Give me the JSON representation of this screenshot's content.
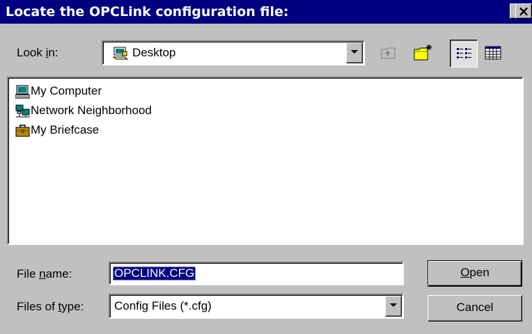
{
  "window": {
    "title": "Locate the OPCLink configuration file:",
    "help_label": "?",
    "close_label": "×"
  },
  "look_in": {
    "label_pre": "Look ",
    "label_accel": "i",
    "label_post": "n:",
    "value": "Desktop",
    "icon": "desktop-icon"
  },
  "toolbar": {
    "up_icon": "up-one-level-icon",
    "new_folder_icon": "new-folder-icon",
    "list_icon": "list-view-icon",
    "details_icon": "details-view-icon"
  },
  "files": [
    {
      "name": "My Computer",
      "icon": "computer-icon"
    },
    {
      "name": "Network Neighborhood",
      "icon": "network-icon"
    },
    {
      "name": "My Briefcase",
      "icon": "briefcase-icon"
    }
  ],
  "file_name": {
    "label_pre": "File ",
    "label_accel": "n",
    "label_post": "ame:",
    "value": "OPCLINK.CFG"
  },
  "file_type": {
    "label_pre": "Files of ",
    "label_accel": "t",
    "label_post": "ype:",
    "value": "Config Files (*.cfg)"
  },
  "buttons": {
    "open_accel": "O",
    "open_rest": "pen",
    "cancel": "Cancel"
  },
  "colors": {
    "titlebar": "#000080",
    "face": "#c0c0c0",
    "selection": "#000080"
  }
}
